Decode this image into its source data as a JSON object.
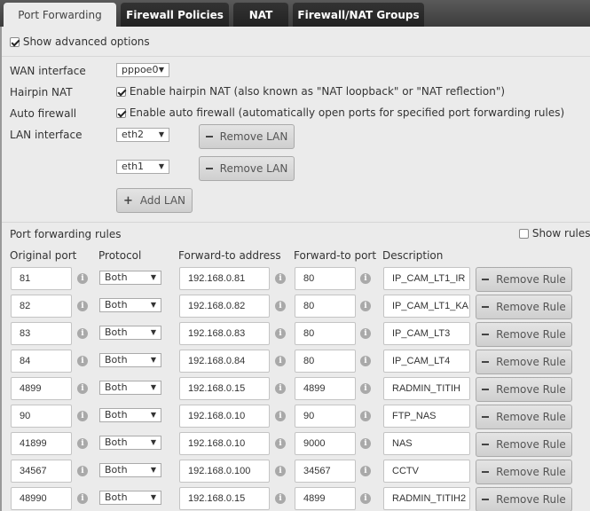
{
  "tabs": [
    {
      "label": "Port Forwarding",
      "active": true
    },
    {
      "label": "Firewall Policies"
    },
    {
      "label": "NAT"
    },
    {
      "label": "Firewall/NAT Groups"
    }
  ],
  "advanced": {
    "label": "Show advanced options",
    "checked": true
  },
  "wan": {
    "label": "WAN interface",
    "value": "pppoe0"
  },
  "hairpin": {
    "label": "Hairpin NAT",
    "text": "Enable hairpin NAT (also known as \"NAT loopback\" or \"NAT reflection\")",
    "checked": true
  },
  "autofw": {
    "label": "Auto firewall",
    "text": "Enable auto firewall (automatically open ports for specified port forwarding rules)",
    "checked": true
  },
  "lan": {
    "label": "LAN interface",
    "interfaces": [
      "eth2",
      "eth1"
    ],
    "remove_label": "Remove LAN",
    "add_label": "Add LAN"
  },
  "rules": {
    "title": "Port forwarding rules",
    "show_rules": "Show rules",
    "headers": {
      "orig": "Original port",
      "proto": "Protocol",
      "addr": "Forward-to address",
      "fport": "Forward-to port",
      "desc": "Description"
    },
    "remove_label": "Remove Rule",
    "rows": [
      {
        "orig": "81",
        "proto": "Both",
        "addr": "192.168.0.81",
        "fport": "80",
        "desc": "IP_CAM_LT1_IR"
      },
      {
        "orig": "82",
        "proto": "Both",
        "addr": "192.168.0.82",
        "fport": "80",
        "desc": "IP_CAM_LT1_KA"
      },
      {
        "orig": "83",
        "proto": "Both",
        "addr": "192.168.0.83",
        "fport": "80",
        "desc": "IP_CAM_LT3"
      },
      {
        "orig": "84",
        "proto": "Both",
        "addr": "192.168.0.84",
        "fport": "80",
        "desc": "IP_CAM_LT4"
      },
      {
        "orig": "4899",
        "proto": "Both",
        "addr": "192.168.0.15",
        "fport": "4899",
        "desc": "RADMIN_TITIH"
      },
      {
        "orig": "90",
        "proto": "Both",
        "addr": "192.168.0.10",
        "fport": "90",
        "desc": "FTP_NAS"
      },
      {
        "orig": "41899",
        "proto": "Both",
        "addr": "192.168.0.10",
        "fport": "9000",
        "desc": "NAS"
      },
      {
        "orig": "34567",
        "proto": "Both",
        "addr": "192.168.0.100",
        "fport": "34567",
        "desc": "CCTV"
      },
      {
        "orig": "48990",
        "proto": "Both",
        "addr": "192.168.0.15",
        "fport": "4899",
        "desc": "RADMIN_TITIH2"
      }
    ]
  }
}
